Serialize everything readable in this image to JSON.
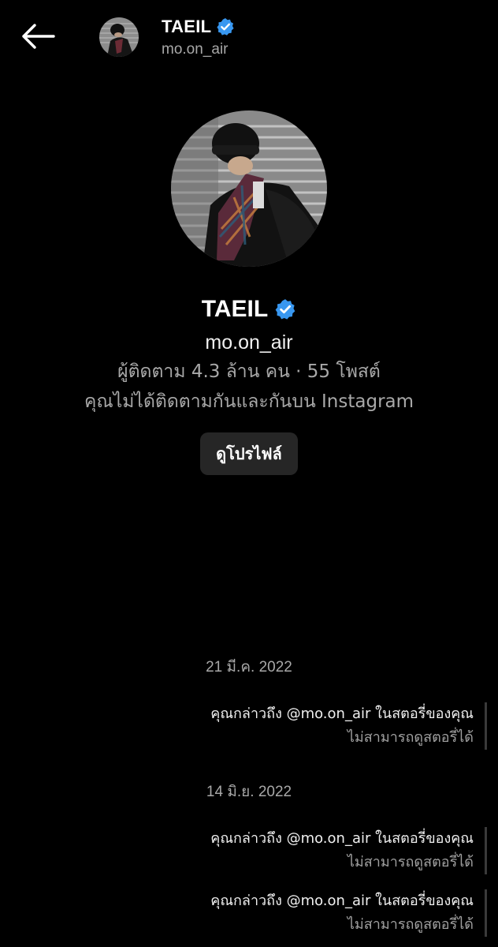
{
  "header": {
    "name": "TAEIL",
    "username": "mo.on_air",
    "back_icon": "arrow-left-icon",
    "verified_icon": "verified-badge-icon"
  },
  "profile": {
    "name": "TAEIL",
    "username": "mo.on_air",
    "stats": "ผู้ติดตาม 4.3 ล้าน คน · 55 โพสต์",
    "mutual": "คุณไม่ได้ติดตามกันและกันบน Instagram",
    "view_profile_label": "ดูโปรไฟล์"
  },
  "messages": [
    {
      "date": "21 มี.ค. 2022",
      "items": [
        {
          "text": "คุณกล่าวถึง @mo.on_air ในสตอรี่ของคุณ",
          "sub": "ไม่สามารถดูสตอรี่ได้"
        }
      ]
    },
    {
      "date": "14 มิ.ย. 2022",
      "items": [
        {
          "text": "คุณกล่าวถึง @mo.on_air ในสตอรี่ของคุณ",
          "sub": "ไม่สามารถดูสตอรี่ได้"
        },
        {
          "text": "คุณกล่าวถึง @mo.on_air ในสตอรี่ของคุณ",
          "sub": "ไม่สามารถดูสตอรี่ได้"
        }
      ]
    }
  ],
  "colors": {
    "background": "#000000",
    "verified": "#3897f0",
    "secondary_text": "#a8a8a8",
    "button_bg": "#262626"
  }
}
